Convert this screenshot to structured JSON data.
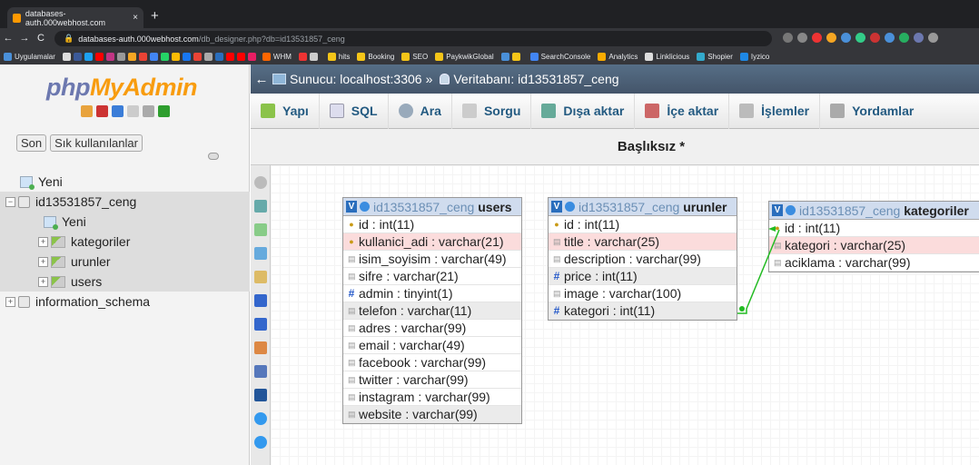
{
  "browser": {
    "tab_title": "databases-auth.000webhost.com",
    "tab_close": "×",
    "new_tab": "+",
    "url_host": "databases-auth.000webhost.com",
    "url_path": "/db_designer.php?db=id13531857_ceng",
    "bookmarks": [
      "Uygulamalar",
      "WHM",
      "hits",
      "Booking",
      "SEO",
      "PaykwikGlobal",
      "SearchConsole",
      "Analytics",
      "Linklicious",
      "Shopier",
      "Iyzico"
    ]
  },
  "sidebar": {
    "logo_a": "php",
    "logo_b": "MyAdmin",
    "tabs": [
      "Son",
      "Sık kullanılanlar"
    ],
    "tree": [
      {
        "label": "Yeni",
        "level": 0
      },
      {
        "label": "id13531857_ceng",
        "level": 0
      },
      {
        "label": "Yeni",
        "level": 1
      },
      {
        "label": "kategoriler",
        "level": 1
      },
      {
        "label": "urunler",
        "level": 1
      },
      {
        "label": "users",
        "level": 1
      },
      {
        "label": "information_schema",
        "level": 0
      }
    ]
  },
  "breadcrumb": {
    "server": "Sunucu: localhost:3306",
    "sep": "»",
    "database": "Veritabanı: id13531857_ceng"
  },
  "menu": [
    "Yapı",
    "SQL",
    "Ara",
    "Sorgu",
    "Dışa aktar",
    "İçe aktar",
    "İşlemler",
    "Yordamlar"
  ],
  "designer_title": "Başlıksız *",
  "tables": {
    "users": {
      "db": "id13531857_ceng",
      "name": "users",
      "columns": [
        "id : int(11)",
        "kullanici_adi : varchar(21)",
        "isim_soyisim : varchar(49)",
        "sifre : varchar(21)",
        "admin : tinyint(1)",
        "telefon : varchar(11)",
        "adres : varchar(99)",
        "email : varchar(49)",
        "facebook : varchar(99)",
        "twitter : varchar(99)",
        "instagram : varchar(99)",
        "website : varchar(99)"
      ]
    },
    "urunler": {
      "db": "id13531857_ceng",
      "name": "urunler",
      "columns": [
        "id : int(11)",
        "title : varchar(25)",
        "description : varchar(99)",
        "price : int(11)",
        "image : varchar(100)",
        "kategori : int(11)"
      ]
    },
    "kategoriler": {
      "db": "id13531857_ceng",
      "name": "kategoriler",
      "columns": [
        "id : int(11)",
        "kategori : varchar(25)",
        "aciklama : varchar(99)"
      ]
    }
  },
  "colors": {
    "accent": "#235a81",
    "relation": "#22bb22",
    "header_bar": "#4e6379"
  }
}
